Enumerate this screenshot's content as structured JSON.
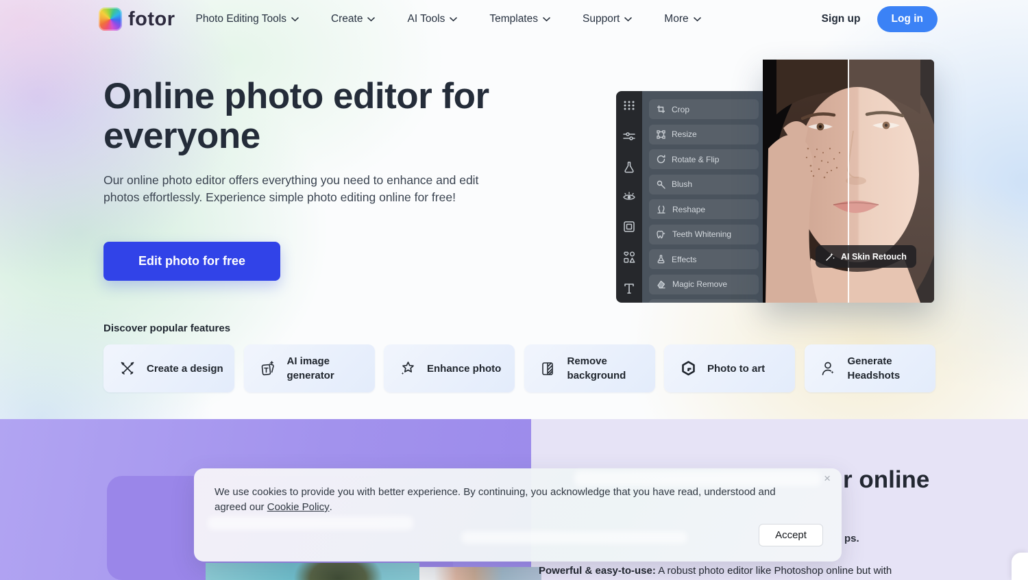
{
  "brand": {
    "name": "fotor"
  },
  "nav": {
    "items": [
      {
        "label": "Photo Editing Tools"
      },
      {
        "label": "Create"
      },
      {
        "label": "AI Tools"
      },
      {
        "label": "Templates"
      },
      {
        "label": "Support"
      },
      {
        "label": "More"
      }
    ],
    "signup": "Sign up",
    "login": "Log in"
  },
  "hero": {
    "title": "Online photo editor for everyone",
    "description": "Our online photo editor offers everything you need to enhance and edit photos effortlessly. Experience simple photo editing online for free!",
    "cta": "Edit photo for free"
  },
  "features": {
    "heading": "Discover popular features",
    "cards": [
      {
        "label": "Create a design",
        "icon": "create-design-icon"
      },
      {
        "label": "AI image generator",
        "icon": "ai-image-generator-icon"
      },
      {
        "label": "Enhance photo",
        "icon": "enhance-photo-icon"
      },
      {
        "label": "Remove background",
        "icon": "remove-background-icon"
      },
      {
        "label": "Photo to art",
        "icon": "photo-to-art-icon"
      },
      {
        "label": "Generate Headshots",
        "icon": "generate-headshots-icon"
      }
    ]
  },
  "editor": {
    "rail_icons": [
      "apps-grid-icon",
      "adjust-sliders-icon",
      "flask-icon",
      "beauty-eye-icon",
      "frame-icon",
      "shapes-icon",
      "text-icon"
    ],
    "menu": [
      {
        "label": "Crop",
        "icon": "crop-icon"
      },
      {
        "label": "Resize",
        "icon": "resize-icon"
      },
      {
        "label": "Rotate & Flip",
        "icon": "rotate-icon"
      },
      {
        "label": "Blush",
        "icon": "blush-icon"
      },
      {
        "label": "Reshape",
        "icon": "reshape-icon"
      },
      {
        "label": "Teeth Whitening",
        "icon": "teeth-icon"
      },
      {
        "label": "Effects",
        "icon": "effects-icon"
      },
      {
        "label": "Magic Remove",
        "icon": "magic-remove-icon"
      }
    ],
    "tooltip": "AI Skin Retouch"
  },
  "cookie": {
    "line1": "We use cookies to provide you with better experience. By continuing, you acknowledge that you have read, understood and",
    "line2_prefix": "agreed our ",
    "link": "Cookie Policy",
    "line2_suffix": ".",
    "accept": "Accept",
    "close": "×"
  },
  "bottom": {
    "heading_fragment": "r online",
    "text_fragment": "ps.",
    "line_bold": "Powerful & easy-to-use:",
    "line_rest": " A robust photo editor like Photoshop online but with"
  },
  "colors": {
    "cta_blue": "#3143e8",
    "login_blue": "#3b82f6",
    "purple": "#a99cee"
  }
}
